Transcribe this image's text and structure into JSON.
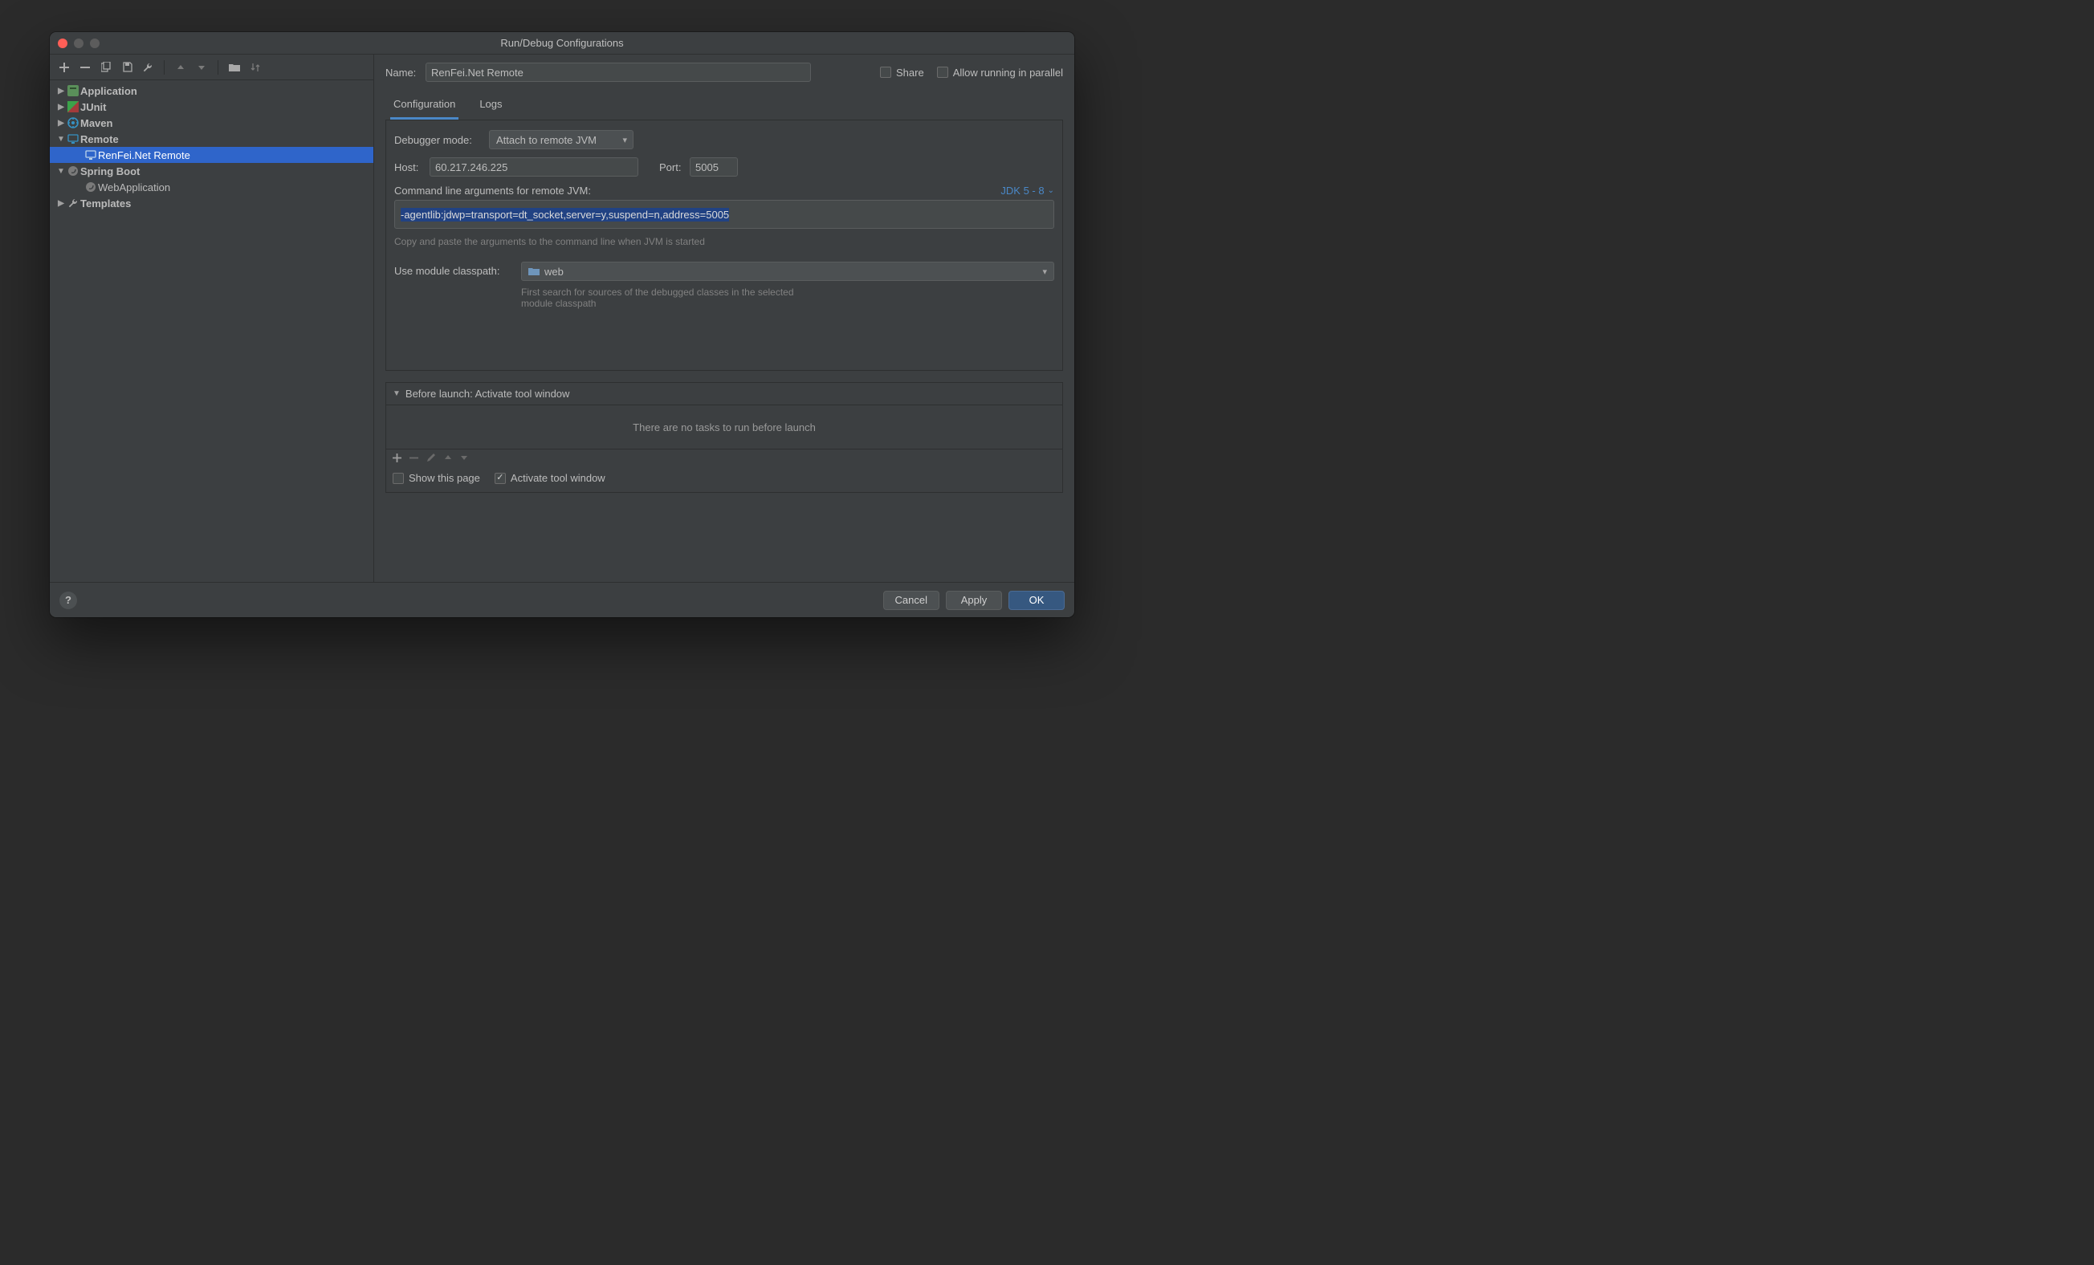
{
  "titlebar": {
    "title": "Run/Debug Configurations"
  },
  "sidebar": {
    "nodes": {
      "application": "Application",
      "junit": "JUnit",
      "maven": "Maven",
      "remote": "Remote",
      "remote_child": "RenFei.Net Remote",
      "springboot": "Spring Boot",
      "springboot_child": "WebApplication",
      "templates": "Templates"
    }
  },
  "header": {
    "name_label": "Name:",
    "name_value": "RenFei.Net Remote",
    "share_label": "Share",
    "parallel_label": "Allow running in parallel"
  },
  "tabs": {
    "configuration": "Configuration",
    "logs": "Logs"
  },
  "config": {
    "debugger_mode_label": "Debugger mode:",
    "debugger_mode_value": "Attach to remote JVM",
    "host_label": "Host:",
    "host_value": "60.217.246.225",
    "port_label": "Port:",
    "port_value": "5005",
    "cmd_label": "Command line arguments for remote JVM:",
    "jdk_label": "JDK 5 - 8",
    "cmd_value": "-agentlib:jdwp=transport=dt_socket,server=y,suspend=n,address=5005",
    "cmd_hint": "Copy and paste the arguments to the command line when JVM is started",
    "module_label": "Use module classpath:",
    "module_value": "web",
    "module_hint1": "First search for sources of the debugged classes in the selected",
    "module_hint2": "module classpath"
  },
  "before_launch": {
    "header": "Before launch: Activate tool window",
    "empty": "There are no tasks to run before launch",
    "show_this_page": "Show this page",
    "activate_tool_window": "Activate tool window"
  },
  "footer": {
    "cancel": "Cancel",
    "apply": "Apply",
    "ok": "OK"
  }
}
